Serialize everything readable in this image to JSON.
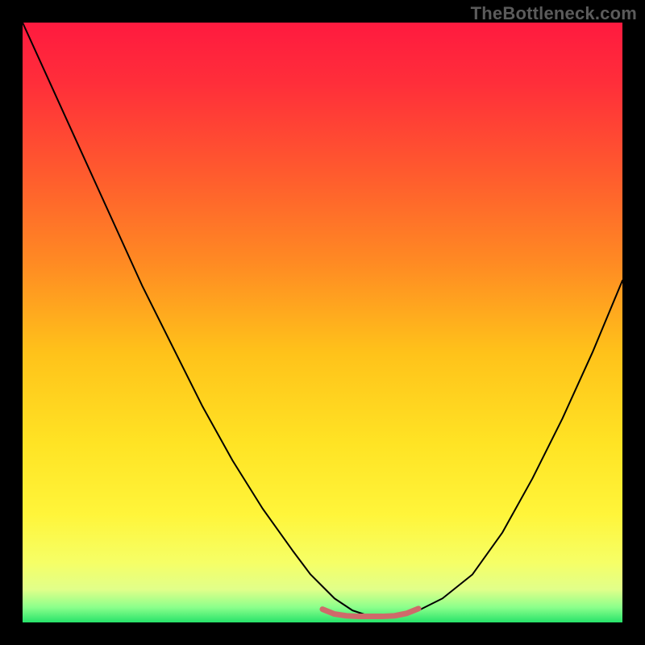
{
  "watermark": "TheBottleneck.com",
  "chart_data": {
    "type": "line",
    "title": "",
    "xlabel": "",
    "ylabel": "",
    "xlim": [
      0,
      100
    ],
    "ylim": [
      0,
      100
    ],
    "grid": false,
    "legend": false,
    "gradient_stops": [
      {
        "offset": 0.0,
        "color": "#ff1a3f"
      },
      {
        "offset": 0.1,
        "color": "#ff2e3a"
      },
      {
        "offset": 0.25,
        "color": "#ff5a2e"
      },
      {
        "offset": 0.4,
        "color": "#ff8a23"
      },
      {
        "offset": 0.55,
        "color": "#ffc21a"
      },
      {
        "offset": 0.7,
        "color": "#ffe324"
      },
      {
        "offset": 0.82,
        "color": "#fff53a"
      },
      {
        "offset": 0.9,
        "color": "#f6ff66"
      },
      {
        "offset": 0.945,
        "color": "#e1ff8a"
      },
      {
        "offset": 0.975,
        "color": "#8bff8b"
      },
      {
        "offset": 1.0,
        "color": "#27e36a"
      }
    ],
    "series": [
      {
        "name": "bottleneck-curve",
        "stroke": "#000000",
        "stroke_width": 2.0,
        "x": [
          0,
          5,
          10,
          15,
          20,
          25,
          30,
          35,
          40,
          45,
          48,
          50,
          52,
          55,
          58,
          60,
          63,
          66,
          70,
          75,
          80,
          85,
          90,
          95,
          100
        ],
        "values": [
          100,
          89,
          78,
          67,
          56,
          46,
          36,
          27,
          19,
          12,
          8,
          6,
          4,
          2,
          1,
          1,
          1,
          2,
          4,
          8,
          15,
          24,
          34,
          45,
          57
        ]
      },
      {
        "name": "floor-marker",
        "stroke": "#cf6a6a",
        "stroke_width": 7.0,
        "x": [
          50,
          52,
          54,
          56,
          58,
          60,
          62,
          64,
          66
        ],
        "values": [
          2.2,
          1.4,
          1.1,
          1.0,
          1.0,
          1.0,
          1.1,
          1.5,
          2.3
        ]
      }
    ]
  }
}
